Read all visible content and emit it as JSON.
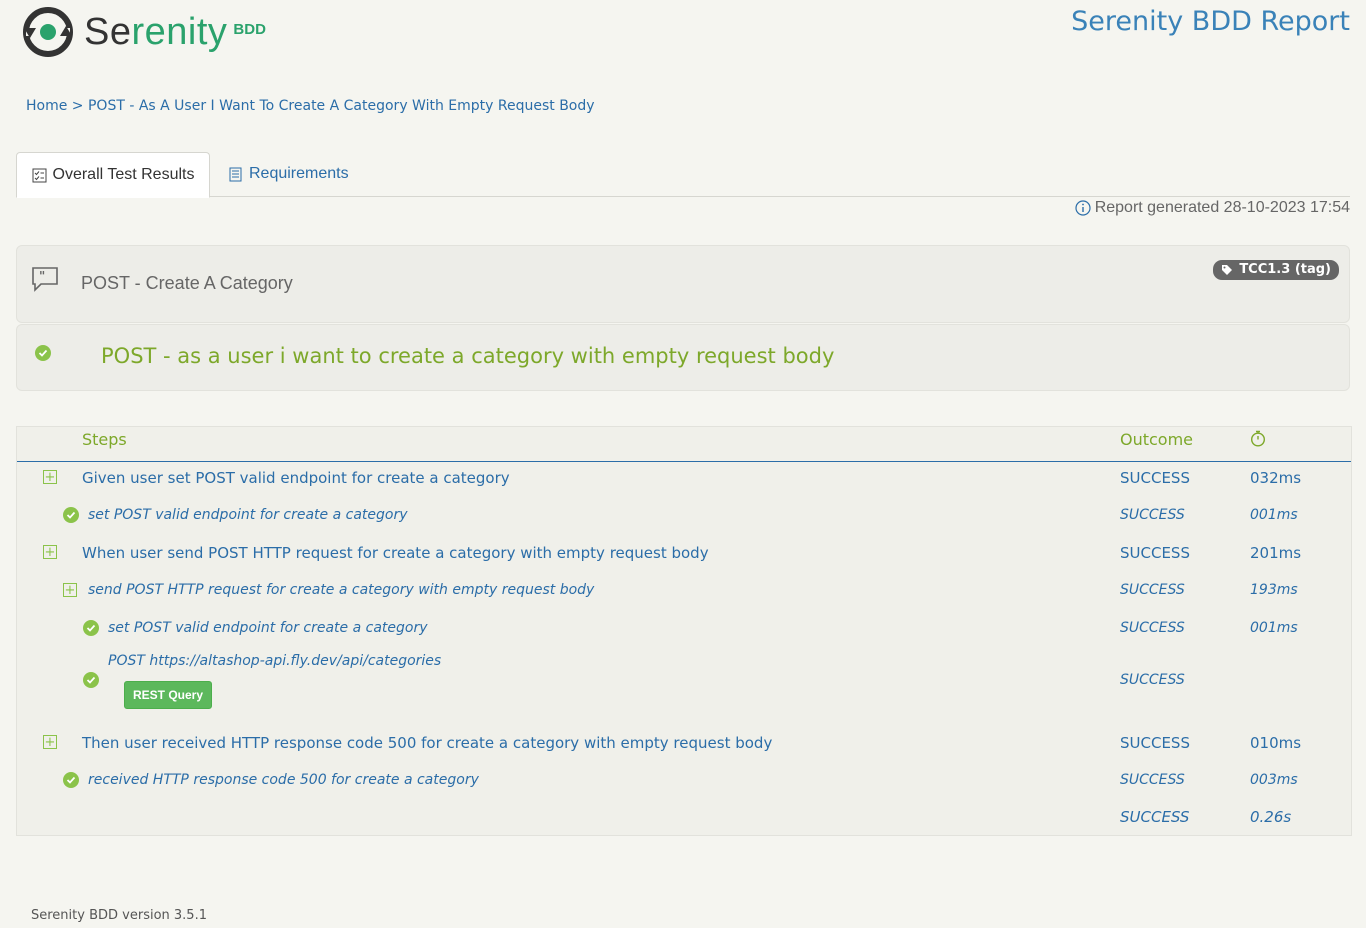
{
  "brand": {
    "name_prefix": "Se",
    "name_rest": "renity",
    "suffix": "BDD"
  },
  "report_title": "Serenity BDD Report",
  "breadcrumb": {
    "home": "Home",
    "separator": ">",
    "current": "POST - As A User I Want To Create A Category With Empty Request Body"
  },
  "tabs": [
    {
      "label": "Overall Test Results",
      "icon": "checklist-icon",
      "active": true
    },
    {
      "label": "Requirements",
      "icon": "document-icon",
      "active": false
    }
  ],
  "generated": "Report generated 28-10-2023 17:54",
  "feature": {
    "title": "POST - Create A Category",
    "tag": "TCC1.3 (tag)"
  },
  "scenario": {
    "title": "POST - as a user i want to create a category with empty request body",
    "status_color": "#8bc34a"
  },
  "steps_table": {
    "headers": {
      "steps": "Steps",
      "outcome": "Outcome",
      "duration_icon": "stopwatch-icon"
    },
    "rows": [
      {
        "desc": "Given user set POST valid endpoint for create a category",
        "outcome": "SUCCESS",
        "duration": "032ms"
      },
      {
        "desc": "set POST valid endpoint for create a category",
        "outcome": "SUCCESS",
        "duration": "001ms"
      },
      {
        "desc": "When user send POST HTTP request for create a category with empty request body",
        "outcome": "SUCCESS",
        "duration": "201ms"
      },
      {
        "desc": "send POST HTTP request for create a category with empty request body",
        "outcome": "SUCCESS",
        "duration": "193ms"
      },
      {
        "desc": "set POST valid endpoint for create a category",
        "outcome": "SUCCESS",
        "duration": "001ms"
      },
      {
        "desc": "POST https://altashop-api.fly.dev/api/categories",
        "outcome": "SUCCESS",
        "duration": "",
        "button": "REST Query"
      },
      {
        "desc": "Then user received HTTP response code 500 for create a category with empty request body",
        "outcome": "SUCCESS",
        "duration": "010ms"
      },
      {
        "desc": "received HTTP response code 500 for create a category",
        "outcome": "SUCCESS",
        "duration": "003ms"
      }
    ],
    "total": {
      "outcome": "SUCCESS",
      "duration": "0.26s"
    }
  },
  "footer": "Serenity BDD version 3.5.1",
  "colors": {
    "accent_blue": "#2b6da8",
    "success_green": "#8bc34a",
    "brand_green": "#2aa26c"
  }
}
